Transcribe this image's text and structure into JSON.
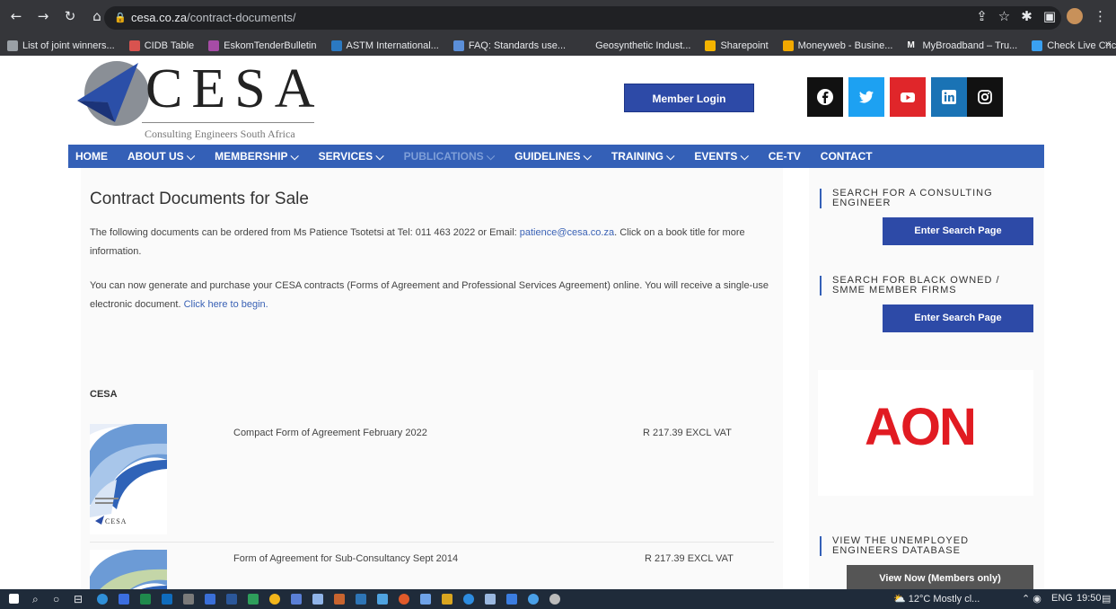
{
  "browser": {
    "url_host": "cesa.co.za",
    "url_path": "/contract-documents/",
    "bookmarks": [
      {
        "label": "List of joint winners...",
        "color": "#9aa0a6"
      },
      {
        "label": "CIDB Table",
        "color": "#d9534f"
      },
      {
        "label": "EskomTenderBulletin",
        "color": "#a64ca6"
      },
      {
        "label": "ASTM International...",
        "color": "#2b79c2"
      },
      {
        "label": "FAQ: Standards use...",
        "color": "#5b8fd9"
      },
      {
        "label": "Geosynthetic Indust...",
        "color": "#35363a"
      },
      {
        "label": "Sharepoint",
        "color": "#f4b400"
      },
      {
        "label": "Moneyweb - Busine...",
        "color": "#f2a900"
      },
      {
        "label": "MyBroadband – Tru...",
        "color": "#ffffff",
        "glyph": "M"
      },
      {
        "label": "Check Live Cricket S...",
        "color": "#3aa0f0"
      }
    ],
    "more_bookmarks": "»"
  },
  "header": {
    "logo_text": "CESA",
    "logo_subtitle": "Consulting Engineers South Africa",
    "login_label": "Member Login",
    "social": [
      {
        "name": "facebook-icon",
        "color": "#111111"
      },
      {
        "name": "twitter-icon",
        "color": "#1da1f2"
      },
      {
        "name": "youtube-icon",
        "color": "#e0262a"
      },
      {
        "name": "linkedin-icon",
        "color": "#1a73b5"
      },
      {
        "name": "instagram-icon",
        "color": "#111111"
      }
    ]
  },
  "nav": [
    {
      "label": "HOME",
      "dim": false
    },
    {
      "label": "ABOUT US ⌵",
      "dim": false
    },
    {
      "label": "MEMBERSHIP ⌵",
      "dim": false
    },
    {
      "label": "SERVICES ⌵",
      "dim": false
    },
    {
      "label": "PUBLICATIONS ⌵",
      "dim": true
    },
    {
      "label": "GUIDELINES ⌵",
      "dim": false
    },
    {
      "label": "TRAINING ⌵",
      "dim": false
    },
    {
      "label": "EVENTS ⌵",
      "dim": false
    },
    {
      "label": "CE-TV",
      "dim": false
    },
    {
      "label": "CONTACT",
      "dim": false
    }
  ],
  "main": {
    "title": "Contract Documents for Sale",
    "para1_a": "The following documents can be ordered from Ms Patience Tsotetsi at Tel: 011 463 2022 or Email: ",
    "para1_email": "patience@cesa.co.za",
    "para1_b": ". Click on a book title for more information.",
    "para2_a": "You can now generate and purchase your CESA contracts (Forms of Agreement and Professional Services Agreement) online. You will receive a single-use electronic document. ",
    "para2_link": "Click here to begin.",
    "section": "CESA",
    "documents": [
      {
        "title": "Compact Form of Agreement February 2022",
        "price": "R 217.39 EXCL VAT"
      },
      {
        "title": "Form of Agreement for Sub-Consultancy Sept 2014",
        "price": "R 217.39 EXCL VAT"
      }
    ],
    "thumb_brand": "CESA"
  },
  "sidebar": {
    "search1_title_l1": "SEARCH FOR A CONSULTING",
    "search1_title_l2": "ENGINEER",
    "search1_button": "Enter Search Page",
    "search2_title_l1": "SEARCH FOR BLACK OWNED /",
    "search2_title_l2": "SMME MEMBER FIRMS",
    "search2_button": "Enter Search Page",
    "ad_text": "AON",
    "db_title_l1": "VIEW THE UNEMPLOYED",
    "db_title_l2": "ENGINEERS DATABASE",
    "db_button": "View Now (Members only)"
  },
  "taskbar": {
    "weather": "12°C Mostly cl...",
    "lang": "ENG",
    "time": "19:50"
  }
}
